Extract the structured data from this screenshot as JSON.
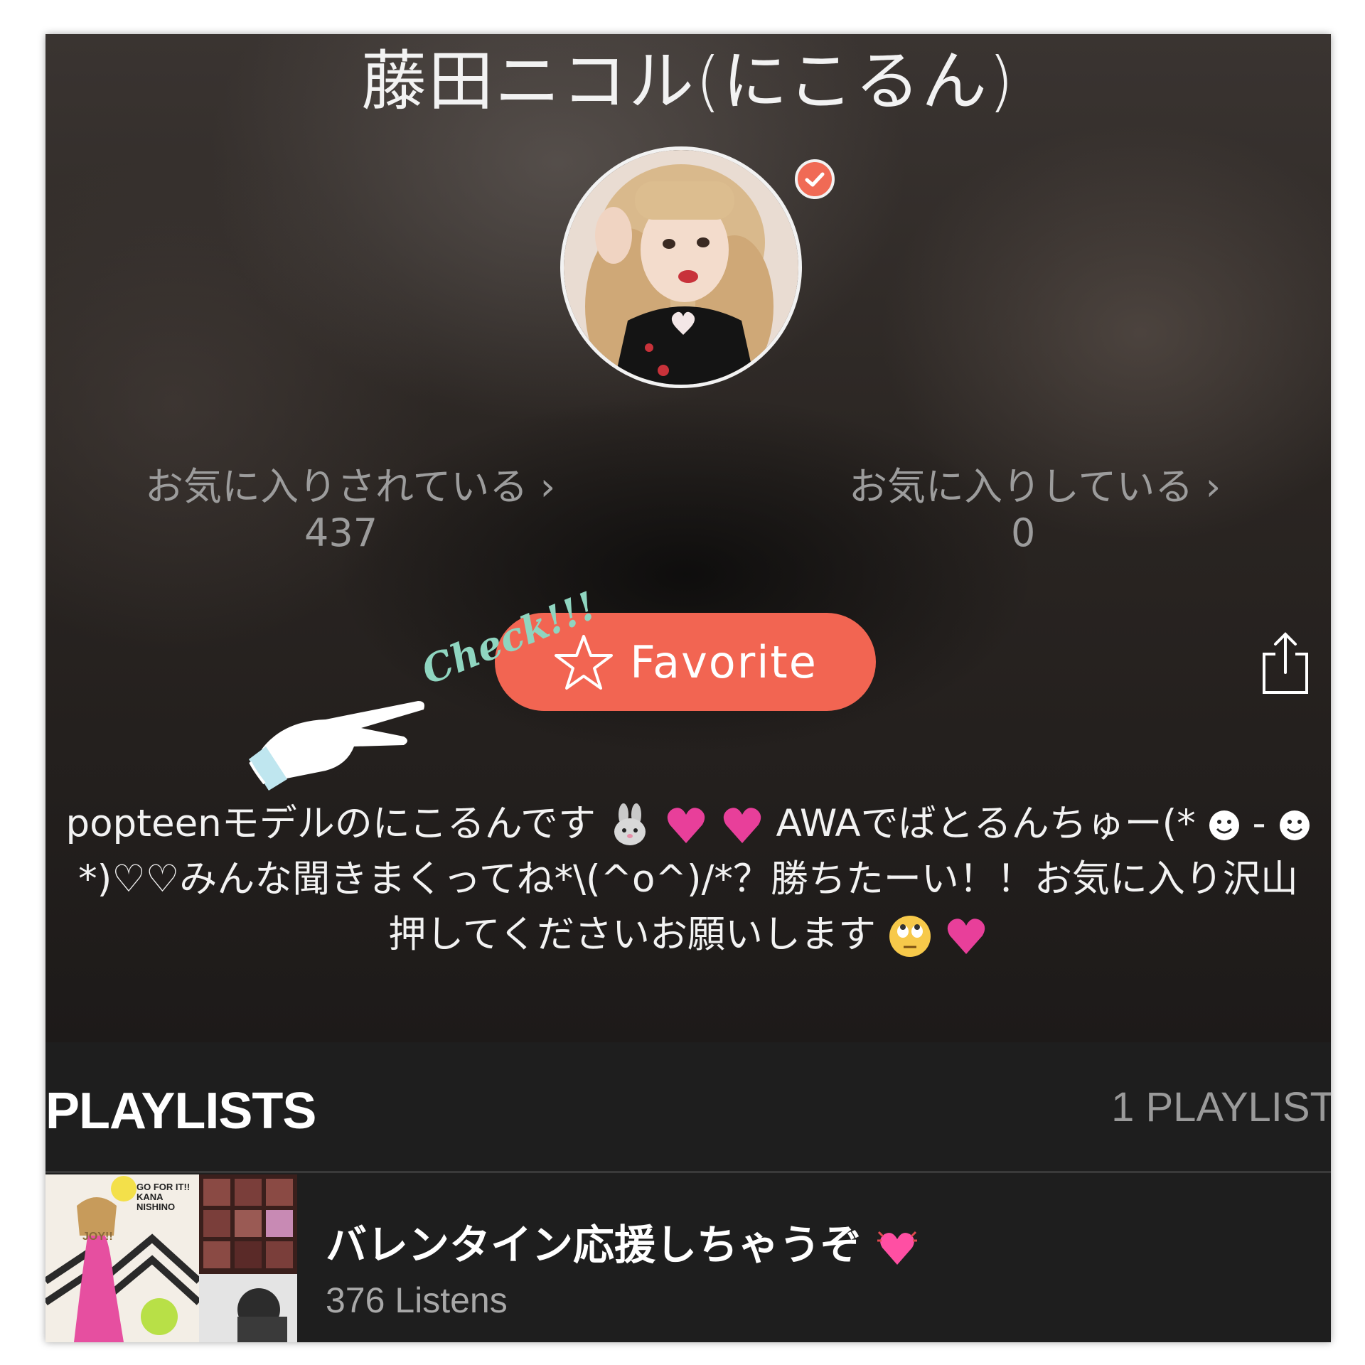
{
  "profile": {
    "name": "藤田ニコル(にこるん)",
    "verified": true
  },
  "stats": {
    "favorited_by_label": "お気に入りされている",
    "favorited_by_count": "437",
    "favoriting_label": "お気に入りしている",
    "favoriting_count": "0",
    "chevron": "›"
  },
  "actions": {
    "favorite_label": "Favorite",
    "favorite_icon": "star-outline-icon",
    "share_icon": "share-icon"
  },
  "annotation": {
    "check_text": "Check!!!"
  },
  "bio": {
    "line1": "popteenモデルのにこるんです",
    "line1b": "AWAでばとるんちゅー(*",
    "line1c": "-",
    "line2": "*)♡♡みんな聞きまくってね*\\(^o^)/*？勝ちたーい！！お気に入り沢山",
    "line3": "押してくださいお願いします"
  },
  "playlists": {
    "header": "PLAYLISTS",
    "count": "1 PLAYLIST",
    "items": [
      {
        "title": "バレンタイン応援しちゃうぞ",
        "listens": "376 Listens",
        "cover_text_1": "GO FOR IT!!",
        "cover_text_2": "KANA",
        "cover_text_3": "NISHINO",
        "cover_text_4": "JOY!!"
      }
    ]
  },
  "colors": {
    "accent": "#f26552",
    "verified_badge": "#f06a55",
    "heart_pink": "#e83f9a"
  }
}
